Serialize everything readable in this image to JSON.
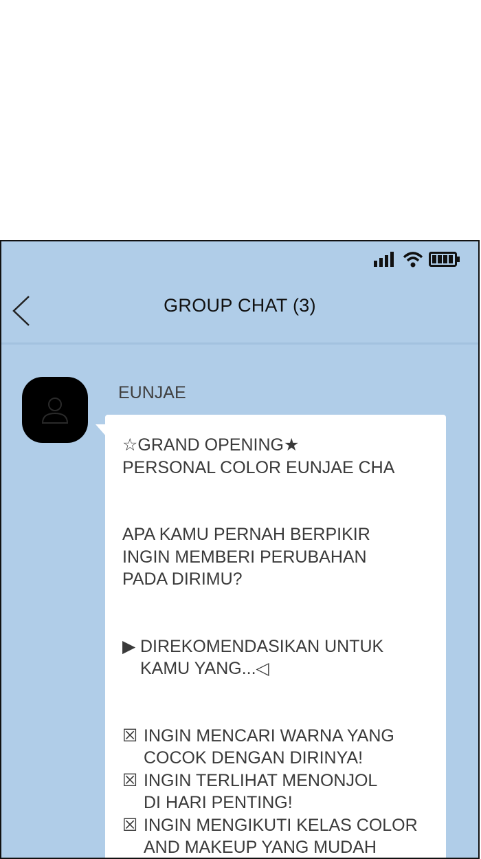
{
  "header": {
    "title": "GROUP CHAT (3)"
  },
  "status_icons": [
    "signal-icon",
    "wifi-icon",
    "battery-icon"
  ],
  "message": {
    "sender": "EUNJAE",
    "lines": {
      "l1_glyph": "☆",
      "l1": "GRAND OPENING★",
      "l2": "PERSONAL COLOR EUNJAE CHA",
      "l3": "APA KAMU PERNAH BERPIKIR",
      "l4": "INGIN MEMBERI PERUBAHAN",
      "l5": "PADA DIRIMU?",
      "l6_glyph": "▶",
      "l6": "DIREKOMENDASIKAN UNTUK",
      "l7": "KAMU YANG...◁",
      "item1_glyph": "☒",
      "item1_a": "INGIN MENCARI WARNA YANG",
      "item1_b": "COCOK DENGAN DIRINYA!",
      "item2_glyph": "☒",
      "item2_a": "INGIN TERLIHAT MENONJOL",
      "item2_b": "DI HARI PENTING!",
      "item3_glyph": "☒",
      "item3_a": "INGIN MENGIKUTI KELAS COLOR",
      "item3_b": "AND MAKEUP YANG MUDAH"
    }
  },
  "colors": {
    "chat_background": "#b0cde8",
    "bubble": "#ffffff",
    "avatar": "#000000"
  }
}
